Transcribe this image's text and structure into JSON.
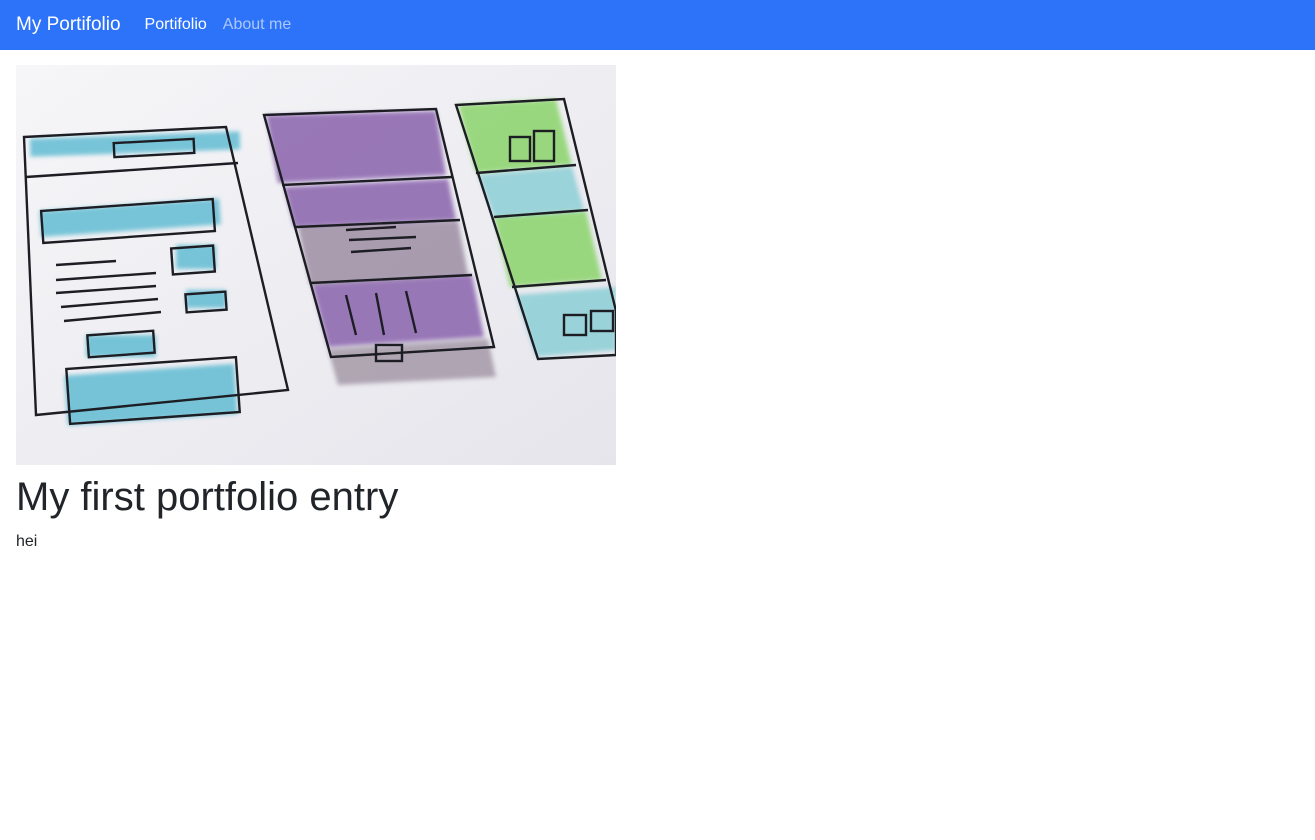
{
  "navbar": {
    "brand": "My Portifolio",
    "links": [
      {
        "label": "Portifolio",
        "active": true
      },
      {
        "label": "About me",
        "active": false
      }
    ],
    "background_color": "#2d73fa"
  },
  "entry": {
    "image_alt": "",
    "title": "My first portfolio entry",
    "body": "hei"
  }
}
